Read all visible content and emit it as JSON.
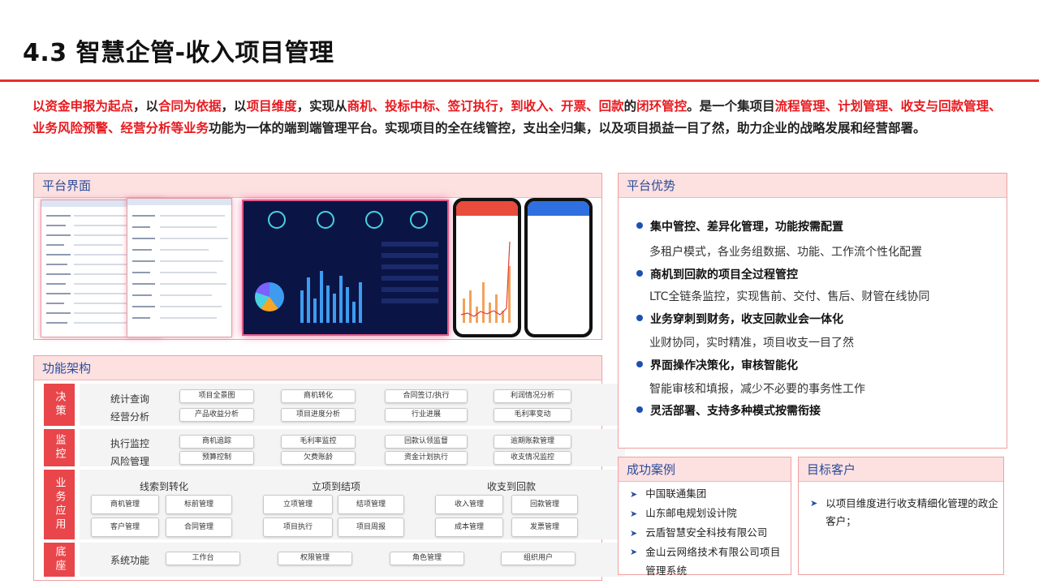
{
  "title": "4.3 智慧企管-收入项目管理",
  "intro": [
    {
      "t": "以资金申报为起点",
      "red": true
    },
    {
      "t": "，以",
      "red": false
    },
    {
      "t": "合同为依据",
      "red": true
    },
    {
      "t": "，以",
      "red": false
    },
    {
      "t": "项目维度",
      "red": true
    },
    {
      "t": "，实现从",
      "red": false
    },
    {
      "t": "商机、投标中标、签订执行，到收入、开票、回款",
      "red": true
    },
    {
      "t": "的",
      "red": false
    },
    {
      "t": "闭环管控",
      "red": true
    },
    {
      "t": "。是一个集项目",
      "red": false
    },
    {
      "t": "流程管理、计划管理、收支与回款管理、业务风险预警、经营分析等业务",
      "red": true
    },
    {
      "t": "功能为一体的端到端管理平台。实现项目的全在线管控，支出全归集，以及项目损益一目了然，助力企业的战略发展和经营部署。",
      "red": false
    }
  ],
  "platform": {
    "heading": "平台界面"
  },
  "architecture": {
    "heading": "功能架构",
    "decision": {
      "category": "决策",
      "labels": [
        "统计查询",
        "经营分析"
      ],
      "row1": [
        "项目全景图",
        "商机转化",
        "合同签订/执行",
        "利润情况分析"
      ],
      "row2": [
        "产品收益分析",
        "项目进度分析",
        "行业进展",
        "毛利率变动"
      ]
    },
    "monitor": {
      "category": "监控",
      "labels": [
        "执行监控",
        "风险管理"
      ],
      "row1": [
        "商机追踪",
        "毛利率监控",
        "回款认领监督",
        "逾期账款管理"
      ],
      "row2": [
        "预算控制",
        "欠费账龄",
        "资金计划执行",
        "收支情况监控"
      ]
    },
    "business": {
      "category": "业务应用",
      "groups": [
        "线索到转化",
        "立项到结项",
        "收支到回款"
      ],
      "row1": [
        "商机管理",
        "标前管理",
        "立项管理",
        "结项管理",
        "收入管理",
        "回款管理"
      ],
      "row2": [
        "客户管理",
        "合同管理",
        "项目执行",
        "项目周报",
        "成本管理",
        "发票管理"
      ]
    },
    "base": {
      "category": "底座",
      "label": "系统功能",
      "items": [
        "工作台",
        "权限管理",
        "角色管理",
        "组织用户"
      ]
    }
  },
  "advantages": {
    "heading": "平台优势",
    "items": [
      {
        "head": "集中管控、差异化管理，功能按需配置",
        "desc": "多租户模式，各业务组数据、功能、工作流个性化配置"
      },
      {
        "head": "商机到回款的项目全过程管控",
        "desc": "LTC全链条监控，实现售前、交付、售后、财管在线协同"
      },
      {
        "head": "业务穿刺到财务，收支回款业会一体化",
        "desc": "业财协同，实时精准，项目收支一目了然"
      },
      {
        "head": "界面操作决策化，审核智能化",
        "desc": "智能审核和填报，减少不必要的事务性工作"
      },
      {
        "head": "灵活部署、支持多种模式按需衔接",
        "desc": ""
      }
    ]
  },
  "cases": {
    "heading": "成功案例",
    "items": [
      "中国联通集团",
      "山东邮电规划设计院",
      "云盾智慧安全科技有限公司",
      "金山云网络技术有限公司项目管理系统"
    ]
  },
  "customers": {
    "heading": "目标客户",
    "items": [
      "以项目维度进行收支精细化管理的政企客户；"
    ]
  },
  "colors": {
    "accent_red": "#e8302e",
    "heading_blue": "#2a4d9c",
    "bullet_blue": "#1f4fb4"
  }
}
